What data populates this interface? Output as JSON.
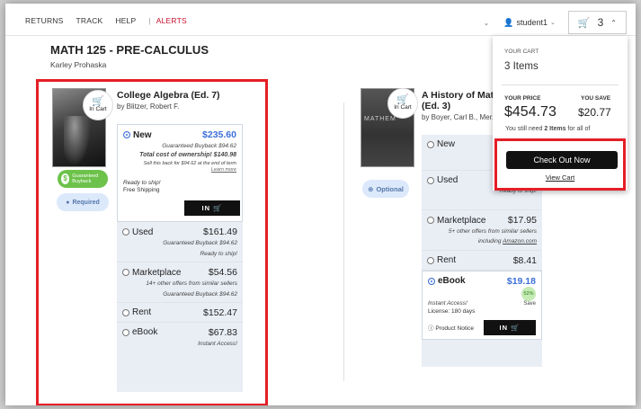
{
  "nav": {
    "returns": "RETURNS",
    "track": "TRACK",
    "help": "HELP",
    "alerts": "ALERTS"
  },
  "user": {
    "name": "student1"
  },
  "cart_button": {
    "count": "3"
  },
  "course": {
    "title": "MATH 125 - PRE-CALCULUS",
    "instructor": "Karley Prohaska"
  },
  "book1": {
    "title": "College Algebra (Ed. 7)",
    "author": "by Blitzer, Robert F.",
    "in_cart": "In Cart",
    "badge_guaranteed": "Guaranteed Buyback",
    "badge_required": "Required",
    "options": {
      "new": {
        "label": "New",
        "price": "$235.60",
        "buyback": "Guaranteed Buyback $94.62",
        "ownership": "Total cost of ownership! $140.98",
        "sell_back": "Sell this back for $94.62 at the end of term",
        "learn_more": "Learn more",
        "ready": "Ready to ship!",
        "shipping": "Free Shipping",
        "in_button": "IN"
      },
      "used": {
        "label": "Used",
        "price": "$161.49",
        "buyback": "Guaranteed Buyback $94.62",
        "ready": "Ready to ship!"
      },
      "marketplace": {
        "label": "Marketplace",
        "price": "$54.56",
        "offers": "14+ other offers from similar sellers",
        "buyback": "Guaranteed Buyback $94.62"
      },
      "rent": {
        "label": "Rent",
        "price": "$152.47"
      },
      "ebook": {
        "label": "eBook",
        "price": "$67.83",
        "access": "Instant Access!"
      }
    }
  },
  "book2": {
    "title_line1": "A History of Math",
    "title_line2": "(Ed. 3)",
    "author": "by Boyer, Carl B., Merzb",
    "in_cart": "In Cart",
    "cover_text": "MATHEM",
    "badge_optional": "Optional",
    "options": {
      "new": {
        "label": "New"
      },
      "used": {
        "label": "Used",
        "ready": "Ready to ship!"
      },
      "marketplace": {
        "label": "Marketplace",
        "price": "$17.95",
        "offers": "5+ other offers from similar sellers",
        "including": "including",
        "amazon": "Amazon.com"
      },
      "rent": {
        "label": "Rent",
        "price": "$8.41"
      },
      "ebook": {
        "label": "eBook",
        "price": "$19.18",
        "access": "Instant Access!",
        "save_pct": "52%",
        "save_label": "Save",
        "license": "License: 180 days",
        "notice": "Product Notice",
        "in_button": "IN"
      }
    }
  },
  "cart_panel": {
    "your_cart": "YOUR CART",
    "items": "3  Items",
    "your_price_label": "YOUR PRICE",
    "you_save_label": "YOU SAVE",
    "price": "$454.73",
    "save": "$20.77",
    "need_prefix": "You still need",
    "need_bold": "2 Items",
    "need_suffix": "for all of",
    "checkout": "Check Out Now",
    "view_cart": "View Cart"
  },
  "colors": {
    "accent_blue": "#3b6fd8",
    "alert_red": "#c8102e",
    "highlight_red": "#e41e26",
    "buyback_green": "#6cc24a"
  }
}
